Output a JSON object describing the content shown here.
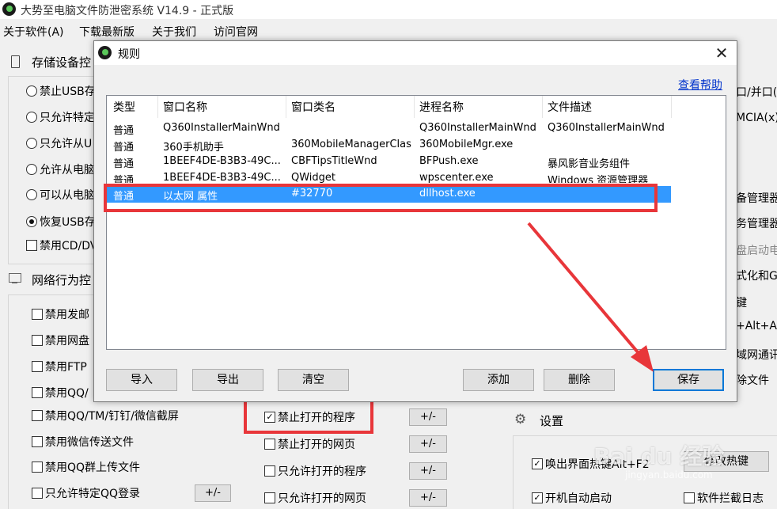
{
  "window": {
    "title": "大势至电脑文件防泄密系统 V14.9 - 正式版"
  },
  "menu": [
    "关于软件(A)",
    "下载最新版",
    "关于我们",
    "访问官网"
  ],
  "left_panel": {
    "storage_header": "存储设备控",
    "storage_options": [
      {
        "label": "禁止USB存",
        "selected": false
      },
      {
        "label": "只允许特定",
        "selected": false
      },
      {
        "label": "只允许从U",
        "selected": false
      },
      {
        "label": "允许从电脑",
        "selected": false
      },
      {
        "label": "可以从电脑",
        "selected": false
      },
      {
        "label": "恢复USB存",
        "selected": true
      }
    ],
    "cd_option": "禁用CD/DV",
    "network_header": "网络行为控",
    "network_options": [
      "禁用发邮",
      "禁用网盘",
      "禁用FTP",
      "禁用QQ/",
      "禁用QQ/TM/钉钉/微信截屏",
      "禁用微信传送文件",
      "禁用QQ群上传文件",
      "只允许特定QQ登录"
    ],
    "plusminus": "+/-"
  },
  "middle_panel": {
    "options": [
      {
        "label": "禁止打开的程序",
        "checked": true
      },
      {
        "label": "禁止打开的网页",
        "checked": false
      },
      {
        "label": "只允许打开的程序",
        "checked": false
      },
      {
        "label": "只允许打开的网页",
        "checked": false
      }
    ],
    "plusminus": "+/-"
  },
  "right_panel": {
    "fragments": [
      "口/并口(x",
      "MCIA(x)",
      "备管理器",
      "务管理器",
      "盘启动电",
      "式化和Gh",
      "键",
      "+Alt+A",
      "域网通讯",
      "除文件"
    ],
    "settings_header": "设置",
    "settings_opts": [
      {
        "label": "唤出界面热键Alt+F2",
        "checked": true
      },
      {
        "label": "开机自动启动",
        "checked": true
      },
      {
        "label": "软件拦截日志",
        "checked": false
      }
    ],
    "hotkey_button": "修改热键"
  },
  "dialog": {
    "title": "规则",
    "help_link": "查看帮助",
    "columns": [
      "类型",
      "窗口名称",
      "窗口类名",
      "进程名称",
      "文件描述"
    ],
    "rows": [
      {
        "type": "普通",
        "window": "Q360InstallerMainWnd",
        "class": "",
        "process": "Q360InstallerMainWnd",
        "desc": "Q360InstallerMainWnd"
      },
      {
        "type": "普通",
        "window": "360手机助手",
        "class": "360MobileManagerClass",
        "process": "360MobileMgr.exe",
        "desc": ""
      },
      {
        "type": "普通",
        "window": "1BEEF4DE-B3B3-49C...",
        "class": "CBFTipsTitleWnd",
        "process": "BFPush.exe",
        "desc": "暴风影音业务组件"
      },
      {
        "type": "普通",
        "window": "1BEEF4DE-B3B3-49C...",
        "class": "QWidget",
        "process": "wpscenter.exe",
        "desc": "Windows 资源管理器"
      },
      {
        "type": "普通",
        "window": "以太网 属性",
        "class": "#32770",
        "process": "dllhost.exe",
        "desc": ""
      }
    ],
    "buttons": {
      "import": "导入",
      "export": "导出",
      "clear": "清空",
      "add": "添加",
      "delete": "删除",
      "save": "保存"
    },
    "close": "✕"
  },
  "watermark": {
    "text": "Bai du 经验",
    "url": "jingyan.baidu.com"
  },
  "colors": {
    "selection": "#3399ff",
    "highlight_red": "#e8363a",
    "link": "#0033cc"
  }
}
